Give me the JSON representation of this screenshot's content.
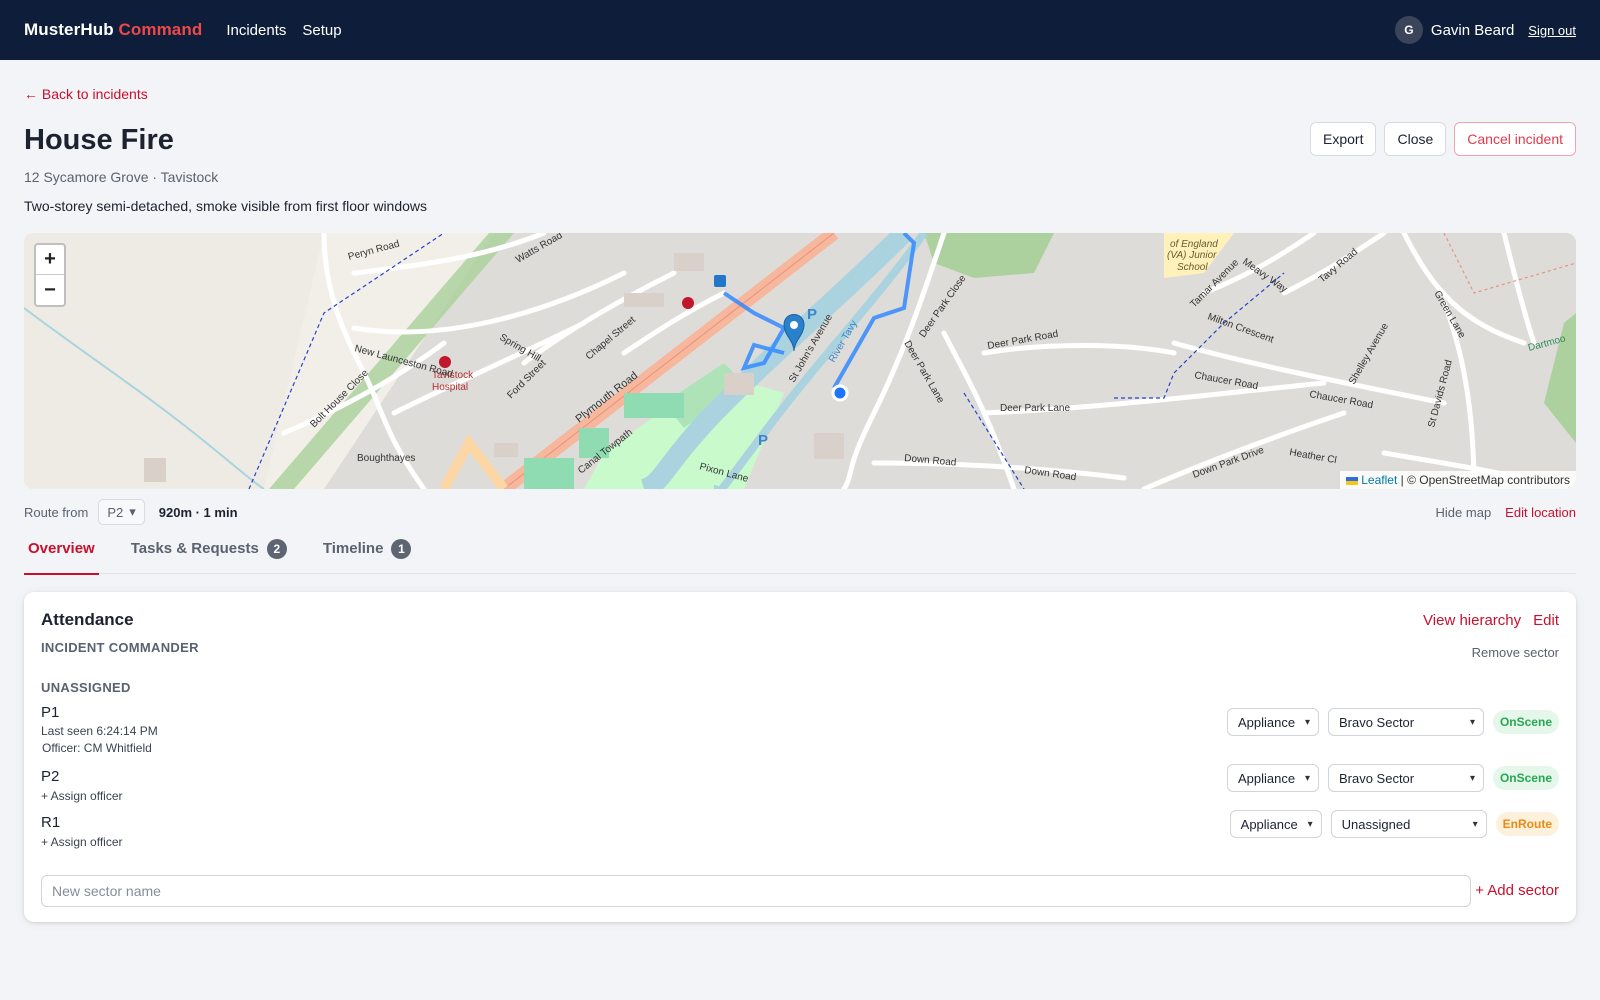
{
  "app": {
    "brand_main": "MusterHub",
    "brand_accent": "Command",
    "nav": [
      "Incidents",
      "Setup"
    ],
    "user_initial": "G",
    "user_name": "Gavin Beard",
    "sign_out": "Sign out"
  },
  "incident": {
    "back_label": "← Back to incidents",
    "title": "House Fire",
    "address": "12 Sycamore Grove · Tavistock",
    "description": "Two-storey semi-detached, smoke visible from first floor windows",
    "actions": {
      "export": "Export",
      "close": "Close",
      "cancel": "Cancel incident"
    }
  },
  "map": {
    "zoom_in": "+",
    "zoom_out": "−",
    "attribution_leaflet": "Leaflet",
    "attribution_rest": "| © OpenStreetMap contributors",
    "labels": {
      "tavistock_hospital_1": "Tavistock",
      "tavistock_hospital_2": "Hospital",
      "plymouth_road": "Plymouth Road",
      "new_launceston_road": "New Launceston Road",
      "spring_hill": "Spring Hill",
      "chapel_street": "Chapel Street",
      "ford_street": "Ford Street",
      "watts_road": "Watts Road",
      "peryn_road": "Peryn Road",
      "bolt_house_close": "Bolt House Close",
      "boughthayes": "Boughthayes",
      "canal_towpath": "Canal Towpath",
      "pixon_lane": "Pixon Lane",
      "river_tavy": "River Tavy",
      "st_johns_avenue": "St John's Avenue",
      "deer_park_close": "Deer Park Close",
      "deer_park_road": "Deer Park Road",
      "deer_park_lane": "Deer Park Lane",
      "down_road": "Down Road",
      "chaucer_road": "Chaucer Road",
      "milton_crescent": "Milton Crescent",
      "tamar_avenue": "Tamar Avenue",
      "meavy_way": "Meavy Way",
      "tavy_road": "Tavy Road",
      "shelley_avenue": "Shelley Avenue",
      "st_davids_road": "St Davids Road",
      "green_lane": "Green Lane",
      "down_park_drive": "Down Park Drive",
      "heather_close": "Heather Cl",
      "school_1": "of England",
      "school_2": "(VA) Junior",
      "school_3": "School",
      "dartmoor": "Dartmoo",
      "parking": "P"
    }
  },
  "route": {
    "label": "Route from",
    "selected": "P2",
    "info": "920m · 1 min",
    "hide_map": "Hide map",
    "edit_location": "Edit location"
  },
  "tabs": [
    {
      "label": "Overview",
      "badge": ""
    },
    {
      "label": "Tasks & Requests",
      "badge": "2"
    },
    {
      "label": "Timeline",
      "badge": "1"
    }
  ],
  "attendance": {
    "title": "Attendance",
    "view_hierarchy": "View hierarchy",
    "edit": "Edit",
    "commander_label": "INCIDENT COMMANDER",
    "remove_sector": "Remove sector",
    "unassigned_label": "UNASSIGNED",
    "units": [
      {
        "name": "P1",
        "meta1": "Last seen 6:24:14 PM",
        "meta2": "Officer: CM Whitfield",
        "type": "Appliance",
        "sector": "Bravo Sector",
        "status": "OnScene"
      },
      {
        "name": "P2",
        "assign": "+ Assign officer",
        "type": "Appliance",
        "sector": "Bravo Sector",
        "status": "OnScene"
      },
      {
        "name": "R1",
        "assign": "+ Assign officer",
        "type": "Appliance",
        "sector": "Unassigned",
        "status": "EnRoute"
      }
    ],
    "new_sector_placeholder": "New sector name",
    "add_sector": "+ Add sector"
  }
}
